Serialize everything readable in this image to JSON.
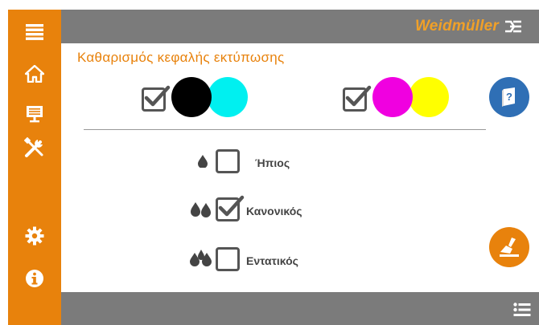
{
  "header": {
    "brand": "Weidmüller"
  },
  "page": {
    "title": "Καθαρισμός κεφαλής εκτύπωσης"
  },
  "options": [
    {
      "label": "Ήπιος",
      "checked": false
    },
    {
      "label": "Κανονικός",
      "checked": true
    },
    {
      "label": "Εντατικός",
      "checked": false
    }
  ],
  "cartridges": [
    {
      "colors": [
        "black",
        "cyan"
      ],
      "checked": true
    },
    {
      "colors": [
        "magenta",
        "yellow"
      ],
      "checked": true
    }
  ],
  "sidebar": {
    "items": [
      {
        "icon": "menu-icon"
      },
      {
        "icon": "home-icon"
      },
      {
        "icon": "monitor-icon"
      },
      {
        "icon": "tools-icon"
      },
      {
        "icon": "gear-icon"
      },
      {
        "icon": "info-icon"
      }
    ]
  },
  "colors": {
    "accent": "#e8820c",
    "bar": "#7b7b7b",
    "help_button": "#2f6fb5",
    "black": "#000000",
    "cyan": "#00f0f0",
    "magenta": "#f000e0",
    "yellow": "#ffff00"
  }
}
